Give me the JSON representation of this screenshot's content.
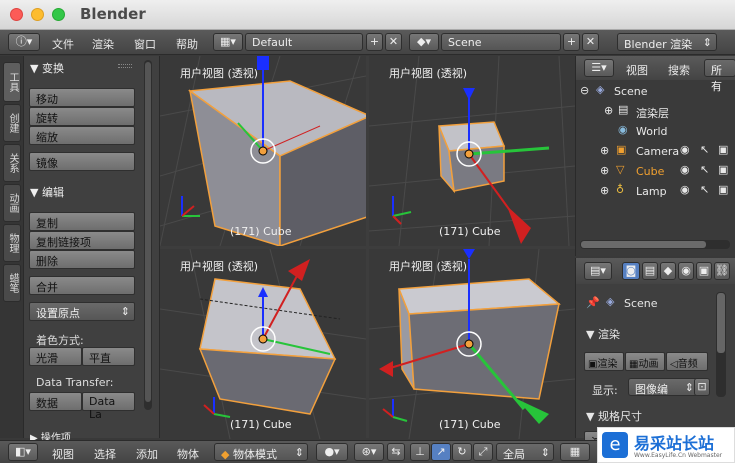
{
  "window": {
    "title": "Blender"
  },
  "topbar": {
    "menus": [
      "文件",
      "渲染",
      "窗口",
      "帮助"
    ],
    "layout": "Default",
    "scene": "Scene",
    "engine": "Blender 渲染"
  },
  "tabs": [
    "工具",
    "创建",
    "关系",
    "动画",
    "物理",
    "蜡笔"
  ],
  "toolshelf": {
    "transform_header": "▼ 变换",
    "transform_buttons": [
      "移动",
      "旋转",
      "缩放",
      "镜像"
    ],
    "edit_header": "▼ 编辑",
    "edit_buttons": [
      "复制",
      "复制链接项",
      "删除",
      "合并"
    ],
    "set_origin": "设置原点",
    "shading_label": "着色方式:",
    "smooth": "光滑",
    "flat": "平直",
    "data_transfer_label": "Data Transfer:",
    "data": "数据",
    "data_layout": "Data La",
    "history_header": "▶ 操作项"
  },
  "viewports": [
    {
      "label": "用户视图 (透视)",
      "object": "(171) Cube"
    },
    {
      "label": "用户视图 (透视)",
      "object": "(171) Cube"
    },
    {
      "label": "用户视图 (透视)",
      "object": "(171) Cube"
    },
    {
      "label": "用户视图 (透视)",
      "object": "(171) Cube"
    }
  ],
  "outliner": {
    "view": "视图",
    "search": "搜索",
    "all": "所有",
    "items": [
      "Scene",
      "渲染层",
      "World",
      "Camera",
      "Cube",
      "Lamp"
    ]
  },
  "properties": {
    "scene": "Scene",
    "render_header": "▼ 渲染",
    "render": "渲染",
    "animation": "动画",
    "audio": "音频",
    "display_label": "显示:",
    "display_value": "图像编",
    "dimensions_header": "▼ 规格尺寸",
    "small_btn": "渲"
  },
  "bottombar": {
    "menus": [
      "视图",
      "选择",
      "添加",
      "物体"
    ],
    "mode": "物体模式",
    "global": "全局"
  },
  "watermark": {
    "text": "易采站长站",
    "sub": "Www.EasyLife.Cn Webmaster"
  },
  "colors": {
    "accent": "#5680c2",
    "select": "#f2a03d",
    "xaxis": "#d12020",
    "yaxis": "#27c43a",
    "zaxis": "#1a2fff"
  }
}
